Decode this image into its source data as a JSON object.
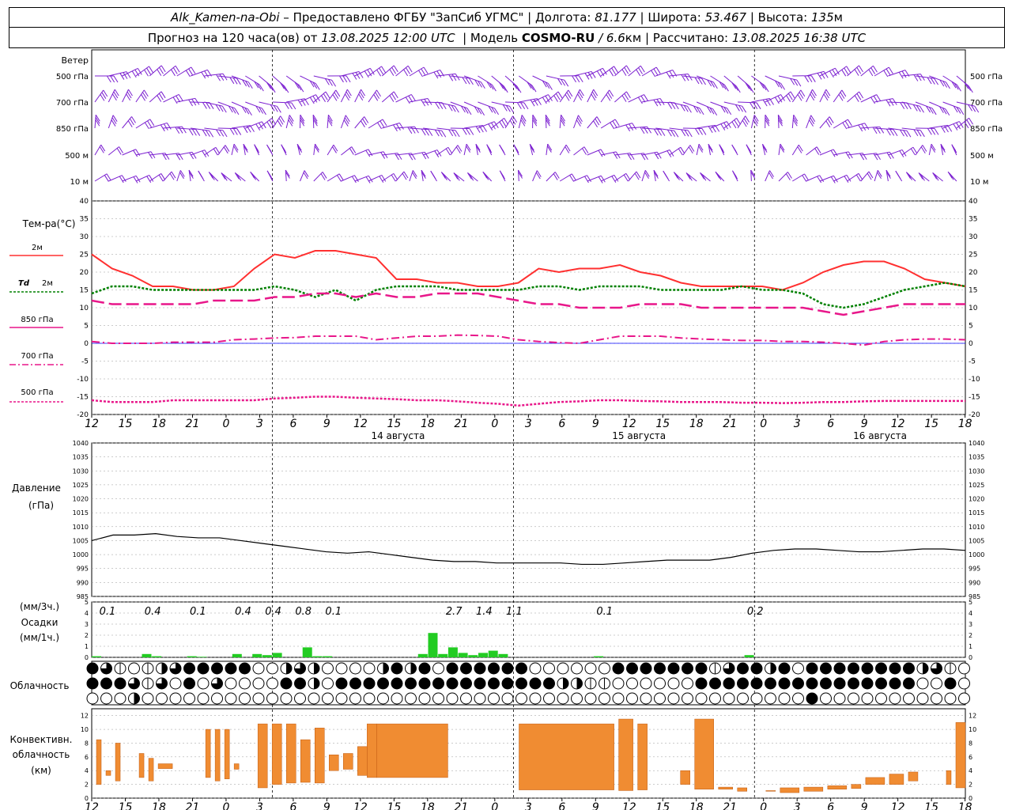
{
  "header": {
    "station": "Alk_Kamen-na-Obi",
    "provider": " – Предоставлено ФГБУ \"ЗапСиб УГМС\" | Долгота: ",
    "lon": "81.177",
    "lat_label": " | Широта: ",
    "lat": "53.467",
    "alt_label": " | Высота: ",
    "alt": "135",
    "alt_unit": "м",
    "forecast_pre": "Прогноз на 120 часа(ов) от ",
    "forecast_time": "13.08.2025 12:00 UTC",
    "model_pre": "  | Модель ",
    "model": "COSMO-RU",
    "model_res": " / 6.6",
    "model_res_unit": "км",
    "calc_pre": " | Рассчитано: ",
    "calc_time": "13.08.2025 16:38 UTC"
  },
  "labels": {
    "wind": "Ветер",
    "wind_levels": [
      "500 гПа",
      "700 гПа",
      "850 гПа",
      "500 м",
      "10  м"
    ],
    "temp": "Тем-ра(°С)",
    "t2m": "2м",
    "td": "Td",
    "td2m": "2м",
    "t850": "850 гПа",
    "t700": "700 гПа",
    "t500": "500 гПа",
    "pressure": "Давление",
    "pressure_unit": "(гПа)",
    "precip_unit3": "(мм/3ч.)",
    "precip": "Осадки",
    "precip_unit1": "(мм/1ч.)",
    "clouds": "Облачность",
    "conv1": "Конвективн.",
    "conv2": "облачность",
    "conv3": "(км)"
  },
  "colors": {
    "t2m": "#ff3030",
    "td": "#008000",
    "t850": "#e8178a",
    "t700": "#e8178a",
    "t500": "#e8178a",
    "wind": "#7b1fd0",
    "precip": "#22cc22",
    "conv": "#f08c32"
  },
  "chart_data": {
    "time_ticks": [
      "12",
      "15",
      "18",
      "21",
      "0",
      "3",
      "6",
      "9",
      "12",
      "15",
      "18",
      "21",
      "0",
      "3",
      "6",
      "9",
      "12",
      "15",
      "18",
      "21",
      "0",
      "3",
      "6",
      "9",
      "12",
      "15",
      "18"
    ],
    "day_labels": [
      "14 августа",
      "15 августа",
      "16 августа"
    ],
    "temperature": {
      "type": "line",
      "ylim": [
        -20,
        40
      ],
      "yticks": [
        40,
        35,
        30,
        25,
        20,
        15,
        10,
        5,
        0,
        -5,
        -10,
        -15,
        -20
      ],
      "series": [
        {
          "name": "2м",
          "values": [
            25,
            21,
            19,
            16,
            16,
            15,
            15,
            16,
            21,
            25,
            24,
            26,
            26,
            25,
            24,
            18,
            18,
            17,
            17,
            16,
            16,
            17,
            21,
            20,
            21,
            21,
            22,
            20,
            19,
            17,
            16,
            16,
            16,
            16,
            15,
            17,
            20,
            22,
            23,
            23,
            21,
            18,
            17,
            16
          ]
        },
        {
          "name": "Td 2м",
          "values": [
            14,
            16,
            16,
            15,
            15,
            15,
            15,
            15,
            15,
            16,
            15,
            13,
            15,
            12,
            15,
            16,
            16,
            16,
            15,
            15,
            15,
            15,
            16,
            16,
            15,
            16,
            16,
            16,
            15,
            15,
            15,
            15,
            16,
            15,
            15,
            14,
            11,
            10,
            11,
            13,
            15,
            16,
            17,
            16
          ]
        },
        {
          "name": "850 гПа",
          "values": [
            12,
            11,
            11,
            11,
            11,
            11,
            12,
            12,
            12,
            13,
            13,
            14,
            14,
            13,
            14,
            13,
            13,
            14,
            14,
            14,
            13,
            12,
            11,
            11,
            10,
            10,
            10,
            11,
            11,
            11,
            10,
            10,
            10,
            10,
            10,
            10,
            9,
            8,
            9,
            10,
            11,
            11,
            11,
            11
          ]
        },
        {
          "name": "700 гПа",
          "values": [
            0.5,
            0,
            0,
            0,
            0.3,
            0.3,
            0.3,
            1,
            1.2,
            1.5,
            1.6,
            2,
            2,
            2,
            1,
            1.5,
            2,
            2,
            2.3,
            2.2,
            2,
            1,
            0.5,
            0.2,
            0,
            1,
            2,
            2,
            2,
            1.5,
            1.2,
            1,
            0.8,
            0.8,
            0.5,
            0.5,
            0.3,
            0,
            -0.5,
            0.5,
            1,
            1.2,
            1.2,
            1
          ]
        },
        {
          "name": "500 гПа",
          "values": [
            -16,
            -16.5,
            -16.5,
            -16.5,
            -16,
            -16,
            -16,
            -16,
            -16,
            -15.5,
            -15.3,
            -15,
            -15,
            -15.3,
            -15.5,
            -15.7,
            -16,
            -16,
            -16.3,
            -16.7,
            -17,
            -17.5,
            -17,
            -16.5,
            -16.3,
            -16,
            -16,
            -16.2,
            -16.3,
            -16.5,
            -16.5,
            -16.5,
            -16.7,
            -16.7,
            -16.8,
            -16.7,
            -16.5,
            -16.5,
            -16.3,
            -16.2,
            -16.2,
            -16.2,
            -16.2,
            -16.2
          ]
        }
      ]
    },
    "pressure": {
      "type": "line",
      "ylim": [
        985,
        1040
      ],
      "yticks": [
        1040,
        1035,
        1030,
        1025,
        1020,
        1015,
        1010,
        1005,
        1000,
        995,
        990,
        985
      ],
      "values": [
        1005,
        1007,
        1007,
        1007.5,
        1006.5,
        1006,
        1006,
        1005,
        1004,
        1003,
        1002,
        1001,
        1000.5,
        1001,
        1000,
        999,
        998,
        997.5,
        997.5,
        997,
        997,
        997,
        997,
        996.5,
        996.5,
        997,
        997.5,
        998,
        998,
        998,
        999,
        1000.5,
        1001.5,
        1002,
        1002,
        1001.5,
        1001,
        1001,
        1001.5,
        1002,
        1002,
        1001.5
      ]
    },
    "precipitation": {
      "type": "bar",
      "ylim": [
        0,
        5
      ],
      "yticks": [
        5,
        4,
        3,
        2,
        1,
        0
      ],
      "labels_3h": [
        {
          "t": 0,
          "v": "0.1"
        },
        {
          "t": 9,
          "v": "0.4"
        },
        {
          "t": 18,
          "v": "0.1"
        },
        {
          "t": 27,
          "v": "0.4"
        },
        {
          "t": 33,
          "v": "0.4"
        },
        {
          "t": 39,
          "v": "0.8"
        },
        {
          "t": 45,
          "v": "0.1"
        },
        {
          "t": 69,
          "v": "2.7"
        },
        {
          "t": 75,
          "v": "1.4"
        },
        {
          "t": 81,
          "v": "1.1"
        },
        {
          "t": 99,
          "v": "0.1"
        },
        {
          "t": 129,
          "v": "0.2"
        }
      ],
      "bars": [
        {
          "t": 0,
          "v": 0.1
        },
        {
          "t": 10,
          "v": 0.3
        },
        {
          "t": 12,
          "v": 0.1
        },
        {
          "t": 19,
          "v": 0.1
        },
        {
          "t": 21,
          "v": 0.05
        },
        {
          "t": 28,
          "v": 0.3
        },
        {
          "t": 32,
          "v": 0.3
        },
        {
          "t": 34,
          "v": 0.2
        },
        {
          "t": 36,
          "v": 0.4
        },
        {
          "t": 42,
          "v": 0.9
        },
        {
          "t": 44,
          "v": 0.1
        },
        {
          "t": 46,
          "v": 0.1
        },
        {
          "t": 65,
          "v": 0.3
        },
        {
          "t": 67,
          "v": 2.2
        },
        {
          "t": 69,
          "v": 0.3
        },
        {
          "t": 71,
          "v": 0.9
        },
        {
          "t": 73,
          "v": 0.4
        },
        {
          "t": 75,
          "v": 0.2
        },
        {
          "t": 77,
          "v": 0.4
        },
        {
          "t": 79,
          "v": 0.6
        },
        {
          "t": 81,
          "v": 0.3
        },
        {
          "t": 100,
          "v": 0.1
        },
        {
          "t": 130,
          "v": 0.2
        }
      ]
    },
    "cloudiness": {
      "type": "table",
      "rows": [
        "4310123444440023200002424044444400000044444441344240444444442310000000000022220044442221130000002100000000000000000000000000000000000000000",
        "444313040300004420444444444444444422110000004444444444444444004040422200100000000000000000000000044444444444444444444443444444444441433422",
        "000200000000000000000000000000000000000000000000000040000000000000000000330000000000000000000000000000000000000000000000000000000000000000"
      ]
    },
    "convective": {
      "type": "bar",
      "ylim": [
        0,
        13
      ],
      "yticks": [
        12,
        10,
        8,
        6,
        4,
        2,
        0
      ],
      "bars": [
        {
          "t0": 1,
          "t1": 2,
          "b": 2,
          "top": 8.5
        },
        {
          "t0": 3,
          "t1": 4,
          "b": 3.3,
          "top": 4
        },
        {
          "t0": 5,
          "t1": 6,
          "b": 2.5,
          "top": 8
        },
        {
          "t0": 10,
          "t1": 11,
          "b": 3,
          "top": 6.5
        },
        {
          "t0": 12,
          "t1": 13,
          "b": 2.5,
          "top": 5.8
        },
        {
          "t0": 14,
          "t1": 17,
          "b": 4.3,
          "top": 5
        },
        {
          "t0": 24,
          "t1": 25,
          "b": 3,
          "top": 10
        },
        {
          "t0": 26,
          "t1": 27,
          "b": 2.5,
          "top": 10
        },
        {
          "t0": 28,
          "t1": 29,
          "b": 2.8,
          "top": 10
        },
        {
          "t0": 30,
          "t1": 31,
          "b": 4.2,
          "top": 5
        },
        {
          "t0": 35,
          "t1": 37,
          "b": 1.5,
          "top": 10.8
        },
        {
          "t0": 38,
          "t1": 40,
          "b": 2,
          "top": 10.8
        },
        {
          "t0": 41,
          "t1": 43,
          "b": 2.2,
          "top": 10.8
        },
        {
          "t0": 44,
          "t1": 46,
          "b": 2.3,
          "top": 8.5
        },
        {
          "t0": 47,
          "t1": 49,
          "b": 2.2,
          "top": 10.2
        },
        {
          "t0": 50,
          "t1": 52,
          "b": 4,
          "top": 6.3
        },
        {
          "t0": 53,
          "t1": 55,
          "b": 4.2,
          "top": 6.5
        },
        {
          "t0": 56,
          "t1": 58,
          "b": 3.3,
          "top": 7.5
        },
        {
          "t0": 58,
          "t1": 60,
          "b": 3,
          "top": 10.8
        },
        {
          "t0": 60,
          "t1": 75,
          "b": 3,
          "top": 10.8
        },
        {
          "t0": 90,
          "t1": 110,
          "b": 1.2,
          "top": 10.8
        },
        {
          "t0": 111,
          "t1": 114,
          "b": 1.1,
          "top": 11.5
        },
        {
          "t0": 115,
          "t1": 117,
          "b": 1.2,
          "top": 10.8
        },
        {
          "t0": 124,
          "t1": 126,
          "b": 2,
          "top": 4
        },
        {
          "t0": 127,
          "t1": 131,
          "b": 1.3,
          "top": 11.5
        },
        {
          "t0": 132,
          "t1": 135,
          "b": 1.3,
          "top": 1.6
        },
        {
          "t0": 136,
          "t1": 138,
          "b": 1,
          "top": 1.5
        },
        {
          "t0": 142,
          "t1": 144,
          "b": 1,
          "top": 1.1
        },
        {
          "t0": 145,
          "t1": 149,
          "b": 0.8,
          "top": 1.5
        },
        {
          "t0": 150,
          "t1": 154,
          "b": 1,
          "top": 1.6
        },
        {
          "t0": 155,
          "t1": 159,
          "b": 1.3,
          "top": 1.8
        },
        {
          "t0": 160,
          "t1": 162,
          "b": 1.4,
          "top": 2
        },
        {
          "t0": 163,
          "t1": 167,
          "b": 2,
          "top": 3
        },
        {
          "t0": 168,
          "t1": 171,
          "b": 2,
          "top": 3.5
        },
        {
          "t0": 172,
          "t1": 174,
          "b": 2.5,
          "top": 3.8
        },
        {
          "t0": 180,
          "t1": 181,
          "b": 2,
          "top": 4
        },
        {
          "t0": 182,
          "t1": 184,
          "b": 1.5,
          "top": 11
        }
      ]
    }
  }
}
